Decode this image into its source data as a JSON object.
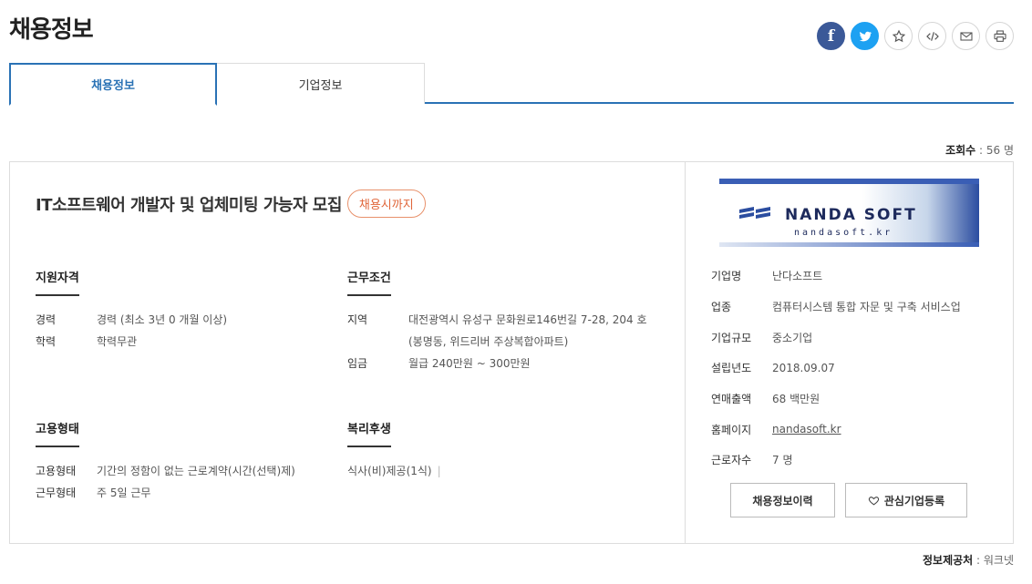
{
  "page": {
    "title": "채용정보"
  },
  "share": {
    "icons": [
      "facebook-icon",
      "twitter-icon",
      "star-icon",
      "code-icon",
      "mail-icon",
      "print-icon"
    ]
  },
  "tabs": [
    {
      "label": "채용정보",
      "active": true
    },
    {
      "label": "기업정보",
      "active": false
    }
  ],
  "views": {
    "label": "조회수",
    "value": "56 명"
  },
  "job": {
    "title": "IT소프트웨어 개발자 및 업체미팅 가능자 모집",
    "deadline": "채용시까지"
  },
  "qualifications": {
    "heading": "지원자격",
    "rows": [
      {
        "k": "경력",
        "v": "경력 (최소 3년 0 개월 이상)"
      },
      {
        "k": "학력",
        "v": "학력무관"
      }
    ]
  },
  "conditions": {
    "heading": "근무조건",
    "rows": [
      {
        "k": "지역",
        "v": "대전광역시 유성구 문화원로146번길 7-28, 204 호 (봉명동, 위드리버 주상복합아파트)"
      },
      {
        "k": "임금",
        "v": "월급 240만원 ~ 300만원"
      }
    ]
  },
  "employment": {
    "heading": "고용형태",
    "rows": [
      {
        "k": "고용형태",
        "v": "기간의 정함이 없는 근로계약(시간(선택)제)"
      },
      {
        "k": "근무형태",
        "v": "주 5일 근무"
      }
    ]
  },
  "welfare": {
    "heading": "복리후생",
    "items": [
      "식사(비)제공(1식)"
    ]
  },
  "company": {
    "logo_text": "NANDA SOFT",
    "logo_sub": "nandasoft.kr",
    "info": [
      {
        "k": "기업명",
        "v": "난다소프트"
      },
      {
        "k": "업종",
        "v": "컴퓨터시스템 통합 자문 및 구축 서비스업"
      },
      {
        "k": "기업규모",
        "v": "중소기업"
      },
      {
        "k": "설립년도",
        "v": "2018.09.07"
      },
      {
        "k": "연매출액",
        "v": "68 백만원"
      },
      {
        "k": "홈페이지",
        "v": "nandasoft.kr",
        "link": true
      },
      {
        "k": "근로자수",
        "v": "7 명"
      }
    ],
    "history_button": "채용정보이력",
    "fav_button": "관심기업등록"
  },
  "source": {
    "label": "정보제공처",
    "value": "워크넷"
  }
}
